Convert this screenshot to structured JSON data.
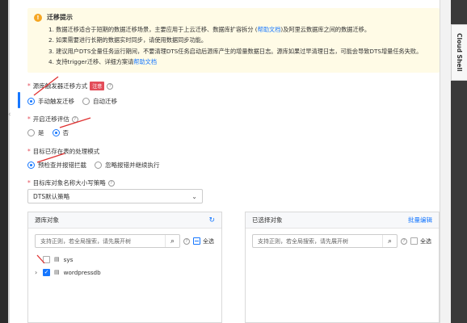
{
  "notice": {
    "title": "迁移提示",
    "items": [
      {
        "prefix": "1. 数据迁移适合于短期的数据迁移场景，主要应用于上云迁移、数据库扩容拆分 (",
        "link": "帮助文档",
        "suffix": ")及阿里云数据库之间的数据迁移。"
      },
      {
        "prefix": "2. 如果需要进行长期的数据实时同步，请使用数据同步功能。",
        "link": "",
        "suffix": ""
      },
      {
        "prefix": "3. 建议用户DTS全量任务运行期间，不要清理DTS任务启动后源库产生的增量数据日志。源库如果过早清理日志，可能会导致DTS增量任务失败。",
        "link": "",
        "suffix": ""
      },
      {
        "prefix": "4. 支持trigger迁移、详细方案请",
        "link": "帮助文档",
        "suffix": ""
      }
    ]
  },
  "trigger_mode": {
    "label": "源库触发器迁移方式",
    "tag": "注意",
    "options": [
      "手动触发迁移",
      "自动迁移"
    ],
    "selected": 0
  },
  "precheck": {
    "label": "开启迁移评估",
    "options": [
      "是",
      "否"
    ],
    "selected": 1
  },
  "existing_table": {
    "label": "目标已存在表的处理模式",
    "options": [
      "预检查并报错拦截",
      "忽略报错并继续执行"
    ],
    "selected": 0
  },
  "case_policy": {
    "label": "目标库对象名称大小写策略",
    "value": "DTS默认策略"
  },
  "source_panel": {
    "title": "源库对象",
    "search_placeholder": "支持正则，若全局搜索，请先展开树",
    "select_all": "全选",
    "items": [
      "sys",
      "wordpressdb"
    ]
  },
  "target_panel": {
    "title": "已选择对象",
    "action": "批量编辑",
    "search_placeholder": "支持正则，若全局搜索，请先展开树",
    "select_all": "全选"
  },
  "side": {
    "cloud_shell": "Cloud Shell"
  },
  "colors": {
    "accent": "#1677ff",
    "warning_bg": "#fffbe6",
    "required": "#e34d59",
    "annotation": "#e03030"
  }
}
